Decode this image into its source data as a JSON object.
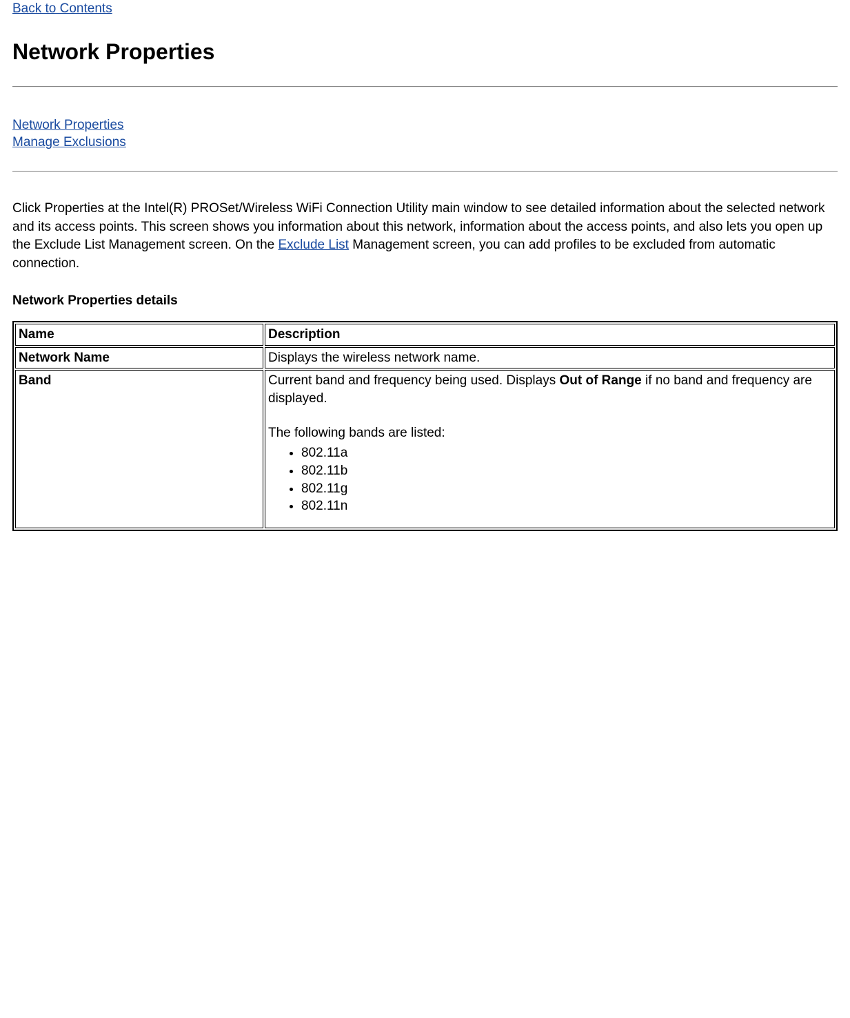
{
  "nav": {
    "back_link": "Back to Contents"
  },
  "title": "Network Properties",
  "toc": {
    "link1": "Network Properties",
    "link2": "Manage Exclusions"
  },
  "intro": {
    "pre": "Click Properties at the Intel(R) PROSet/Wireless WiFi Connection Utility main window to see detailed information about the selected network and its access points. This screen shows you information about this network, information about the access points, and also lets you open up the Exclude List Management screen. On the ",
    "link": "Exclude List",
    "post": " Management screen, you can add profiles to be excluded from automatic connection."
  },
  "subhead": "Network Properties details",
  "table": {
    "headers": {
      "name": "Name",
      "description": "Description"
    },
    "rows": {
      "network_name": {
        "name": "Network Name",
        "description": "Displays the wireless network name."
      },
      "band": {
        "name": "Band",
        "desc_pre": "Current band and frequency being used. Displays ",
        "desc_bold": "Out of Range",
        "desc_post": " if no band and frequency are displayed.",
        "bands_intro": "The following bands are listed:",
        "bands": [
          "802.11a",
          "802.11b",
          "802.11g",
          "802.11n"
        ]
      }
    }
  }
}
